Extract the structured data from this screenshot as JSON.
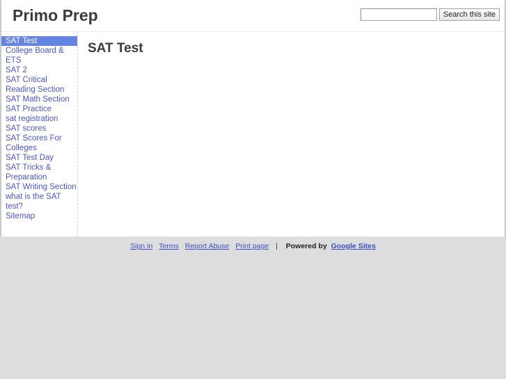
{
  "header": {
    "site_title": "Primo Prep",
    "search": {
      "value": "",
      "placeholder": "",
      "button_label": "Search this site"
    }
  },
  "sidebar": {
    "items": [
      {
        "label": "SAT Test",
        "selected": true
      },
      {
        "label": "College Board & ETS",
        "selected": false
      },
      {
        "label": "SAT 2",
        "selected": false
      },
      {
        "label": "SAT Critical Reading Section",
        "selected": false
      },
      {
        "label": "SAT Math Section",
        "selected": false
      },
      {
        "label": "SAT Practice",
        "selected": false
      },
      {
        "label": "sat registration",
        "selected": false
      },
      {
        "label": "SAT scores",
        "selected": false
      },
      {
        "label": "SAT Scores For Colleges",
        "selected": false
      },
      {
        "label": "SAT Test Day",
        "selected": false
      },
      {
        "label": "SAT Tricks & Preparation",
        "selected": false
      },
      {
        "label": "SAT Writing Section",
        "selected": false
      },
      {
        "label": "what is the SAT test?",
        "selected": false
      },
      {
        "label": "Sitemap",
        "selected": false
      }
    ]
  },
  "main": {
    "page_title": "SAT Test",
    "page_body": ""
  },
  "footer": {
    "sign_in": "Sign in",
    "terms": "Terms",
    "report_abuse": "Report Abuse",
    "print_page": "Print page",
    "separator": "|",
    "powered_by": "Powered by",
    "google_sites": "Google Sites"
  },
  "colors": {
    "selected_nav_bg": "#6583e0",
    "link": "#4a55cc",
    "page_bg": "#dddddd",
    "content_bg": "#ffffff",
    "title_text": "#3b3b3b"
  }
}
